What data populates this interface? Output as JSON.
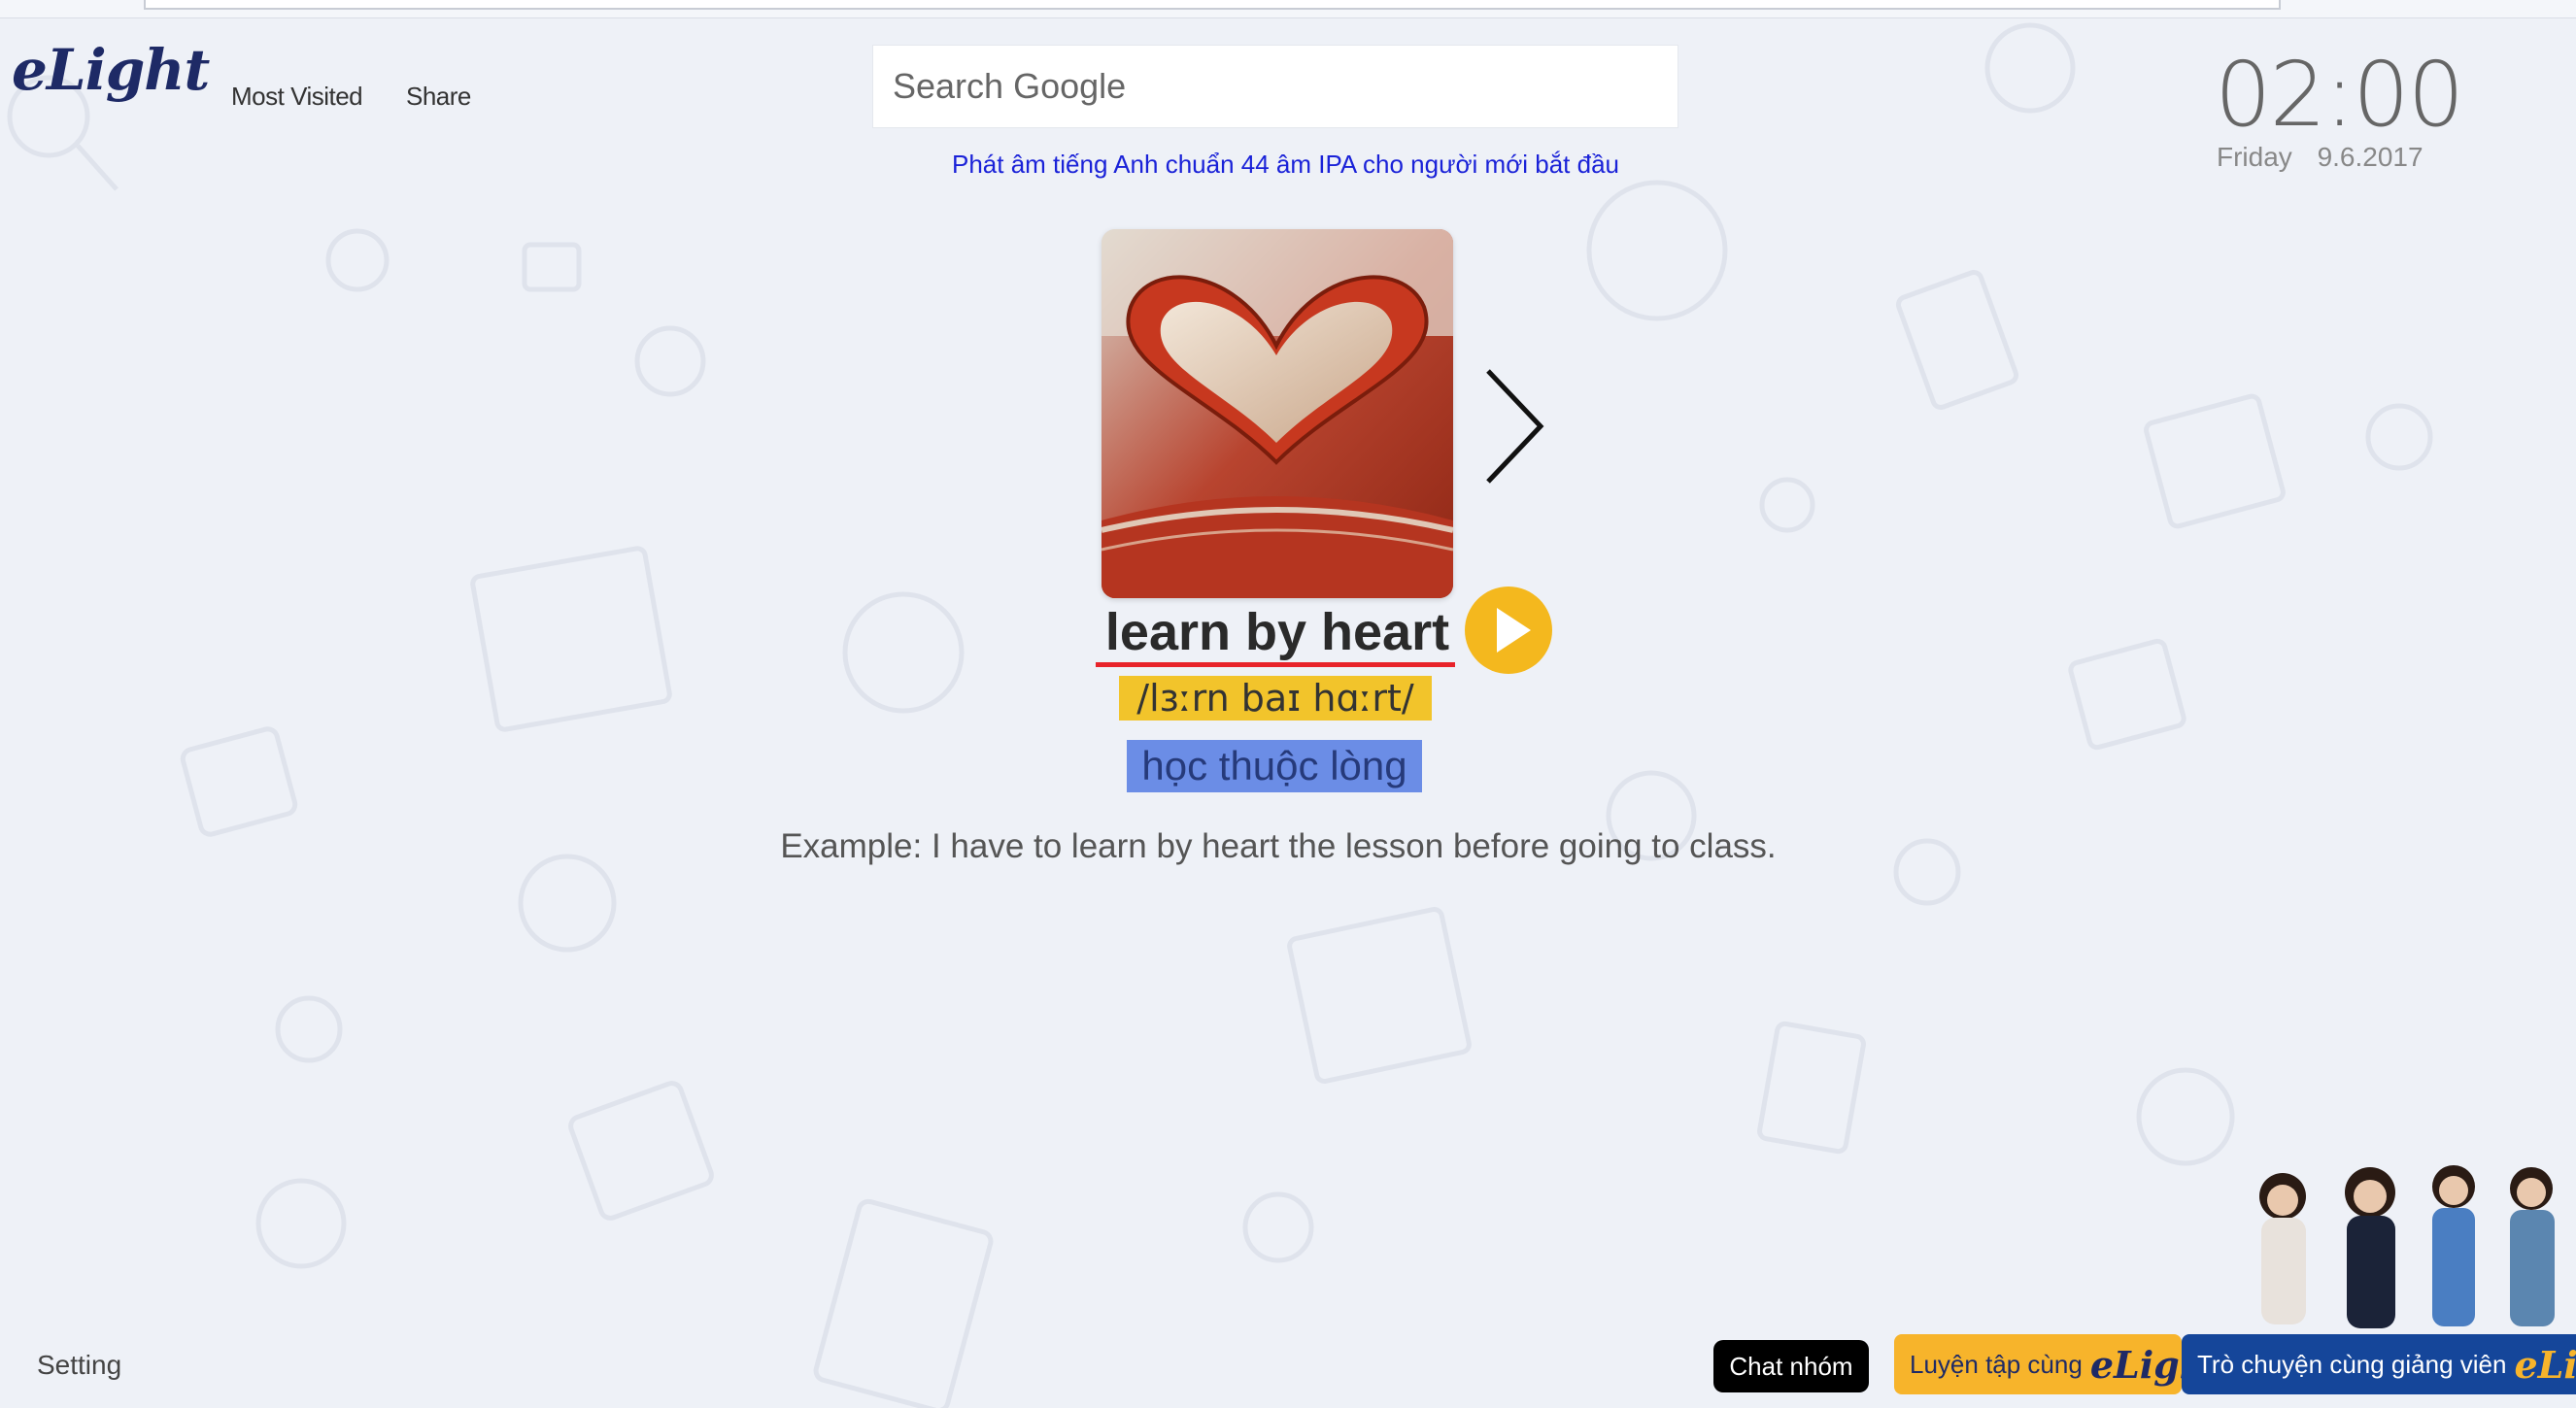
{
  "brand": {
    "logo_text": "eLight"
  },
  "nav": {
    "most_visited": "Most Visited",
    "share": "Share"
  },
  "search": {
    "placeholder": "Search Google"
  },
  "promo": {
    "text": "Phát âm tiếng Anh chuẩn 44 âm IPA cho người mới bắt đầu"
  },
  "clock": {
    "time": "02:00",
    "weekday": "Friday",
    "date": "9.6.2017"
  },
  "card": {
    "word": "learn by heart",
    "ipa": "/lɜːrn baɪ hɑːrt/",
    "meaning": "học thuộc lòng",
    "example": "Example: I have to learn by heart the lesson before going to class.",
    "image_icon": "heart-book-image",
    "next_icon": "chevron-right-icon",
    "play_icon": "play-icon"
  },
  "footer": {
    "setting": "Setting",
    "chat_group": "Chat nhóm",
    "practice_label": "Luyện tập cùng",
    "practice_brand": "eLight",
    "talk_label": "Trò chuyện cùng giảng viên",
    "talk_brand": "eLight"
  },
  "colors": {
    "background": "#eef1f7",
    "brand_navy": "#1e2a66",
    "play_yellow": "#f4b81e",
    "ipa_highlight": "#f2c42b",
    "meaning_highlight": "#6b8de6",
    "underline_red": "#e8232a",
    "talk_blue": "#15469a",
    "practice_orange": "#f7b42b"
  }
}
